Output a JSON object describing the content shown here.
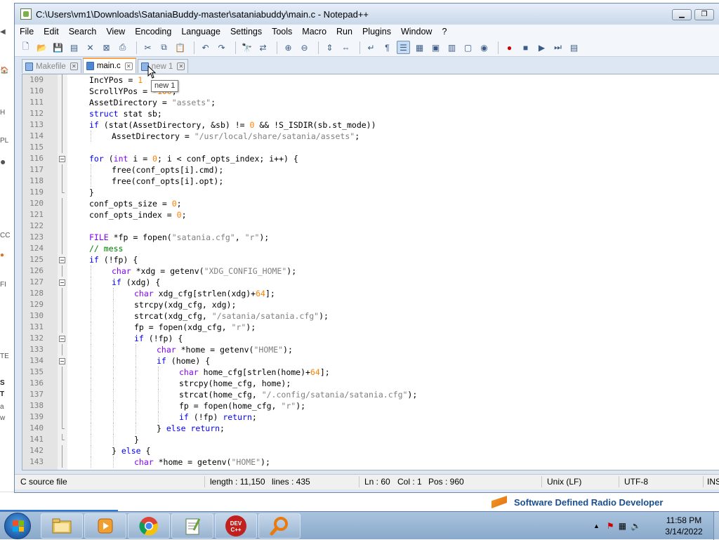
{
  "window": {
    "title": "C:\\Users\\vm1\\Downloads\\SataniaBuddy-master\\sataniabuddy\\main.c - Notepad++"
  },
  "menu": [
    "File",
    "Edit",
    "Search",
    "View",
    "Encoding",
    "Language",
    "Settings",
    "Tools",
    "Macro",
    "Run",
    "Plugins",
    "Window",
    "?"
  ],
  "tabs": [
    {
      "label": "Makefile",
      "active": false
    },
    {
      "label": "main.c",
      "active": true
    },
    {
      "label": "new 1",
      "active": false
    }
  ],
  "tooltip": "new 1",
  "code_lines": [
    {
      "n": "109",
      "fold": "bar",
      "indent": 1,
      "html": "IncYPos = <span class='n'>1</span>"
    },
    {
      "n": "110",
      "fold": "bar",
      "indent": 1,
      "html": "ScrollYPos = <span class='n'>-100</span>;"
    },
    {
      "n": "111",
      "fold": "bar",
      "indent": 1,
      "html": "AssetDirectory = <span class='s'>\"assets\"</span>;"
    },
    {
      "n": "112",
      "fold": "bar",
      "indent": 1,
      "html": "<span class='k'>struct</span> stat sb;"
    },
    {
      "n": "113",
      "fold": "bar",
      "indent": 1,
      "html": "<span class='k'>if</span> (stat(AssetDirectory, &amp;sb) != <span class='n'>0</span> &amp;&amp; !S_ISDIR(sb.st_mode))"
    },
    {
      "n": "114",
      "fold": "bar",
      "indent": 2,
      "html": "AssetDirectory = <span class='s'>\"/usr/local/share/satania/assets\"</span>;"
    },
    {
      "n": "115",
      "fold": "bar",
      "indent": 0,
      "html": ""
    },
    {
      "n": "116",
      "fold": "box",
      "indent": 1,
      "html": "<span class='k'>for</span> (<span class='t'>int</span> i = <span class='n'>0</span>; i &lt; conf_opts_index; i++) {"
    },
    {
      "n": "117",
      "fold": "bar",
      "indent": 2,
      "html": "free(conf_opts[i].cmd);"
    },
    {
      "n": "118",
      "fold": "bar",
      "indent": 2,
      "html": "free(conf_opts[i].opt);"
    },
    {
      "n": "119",
      "fold": "end",
      "indent": 1,
      "html": "}"
    },
    {
      "n": "120",
      "fold": "bar",
      "indent": 1,
      "html": "conf_opts_size = <span class='n'>0</span>;"
    },
    {
      "n": "121",
      "fold": "bar",
      "indent": 1,
      "html": "conf_opts_index = <span class='n'>0</span>;"
    },
    {
      "n": "122",
      "fold": "bar",
      "indent": 0,
      "html": ""
    },
    {
      "n": "123",
      "fold": "bar",
      "indent": 1,
      "html": "<span class='t'>FILE</span> *fp = fopen(<span class='s'>\"satania.cfg\"</span>, <span class='s'>\"r\"</span>);"
    },
    {
      "n": "124",
      "fold": "bar",
      "indent": 1,
      "html": "<span class='c'>// mess</span>"
    },
    {
      "n": "125",
      "fold": "box",
      "indent": 1,
      "html": "<span class='k'>if</span> (!fp) {"
    },
    {
      "n": "126",
      "fold": "bar",
      "indent": 2,
      "html": "<span class='t'>char</span> *xdg = getenv(<span class='s'>\"XDG_CONFIG_HOME\"</span>);"
    },
    {
      "n": "127",
      "fold": "box",
      "indent": 2,
      "html": "<span class='k'>if</span> (xdg) {"
    },
    {
      "n": "128",
      "fold": "bar",
      "indent": 3,
      "html": "<span class='t'>char</span> xdg_cfg[strlen(xdg)+<span class='n'>64</span>];"
    },
    {
      "n": "129",
      "fold": "bar",
      "indent": 3,
      "html": "strcpy(xdg_cfg, xdg);"
    },
    {
      "n": "130",
      "fold": "bar",
      "indent": 3,
      "html": "strcat(xdg_cfg, <span class='s'>\"/satania/satania.cfg\"</span>);"
    },
    {
      "n": "131",
      "fold": "bar",
      "indent": 3,
      "html": "fp = fopen(xdg_cfg, <span class='s'>\"r\"</span>);"
    },
    {
      "n": "132",
      "fold": "box",
      "indent": 3,
      "html": "<span class='k'>if</span> (!fp) {"
    },
    {
      "n": "133",
      "fold": "bar",
      "indent": 4,
      "html": "<span class='t'>char</span> *home = getenv(<span class='s'>\"HOME\"</span>);"
    },
    {
      "n": "134",
      "fold": "box",
      "indent": 4,
      "html": "<span class='k'>if</span> (home) {"
    },
    {
      "n": "135",
      "fold": "bar",
      "indent": 5,
      "html": "<span class='t'>char</span> home_cfg[strlen(home)+<span class='n'>64</span>];"
    },
    {
      "n": "136",
      "fold": "bar",
      "indent": 5,
      "html": "strcpy(home_cfg, home);"
    },
    {
      "n": "137",
      "fold": "bar",
      "indent": 5,
      "html": "strcat(home_cfg, <span class='s'>\"/.config/satania/satania.cfg\"</span>);"
    },
    {
      "n": "138",
      "fold": "bar",
      "indent": 5,
      "html": "fp = fopen(home_cfg, <span class='s'>\"r\"</span>);"
    },
    {
      "n": "139",
      "fold": "bar",
      "indent": 5,
      "html": "<span class='k'>if</span> (!fp) <span class='k'>return</span>;"
    },
    {
      "n": "140",
      "fold": "end",
      "indent": 4,
      "html": "} <span class='k'>else</span> <span class='k'>return</span>;"
    },
    {
      "n": "141",
      "fold": "end",
      "indent": 3,
      "html": "}"
    },
    {
      "n": "142",
      "fold": "bar",
      "indent": 2,
      "html": "} <span class='k'>else</span> {"
    },
    {
      "n": "143",
      "fold": "bar",
      "indent": 3,
      "html": "<span class='t'>char</span> *home = getenv(<span class='s'>\"HOME\"</span>);"
    }
  ],
  "status": {
    "language": "C source file",
    "length": "length : 11,150",
    "lines": "lines : 435",
    "ln": "Ln : 60",
    "col": "Col : 1",
    "pos": "Pos : 960",
    "eol": "Unix (LF)",
    "encoding": "UTF-8",
    "ins": "INS"
  },
  "background": {
    "banner": "Software Defined Radio Developer"
  },
  "taskbar": {
    "time": "11:58 PM",
    "date": "3/14/2022"
  }
}
